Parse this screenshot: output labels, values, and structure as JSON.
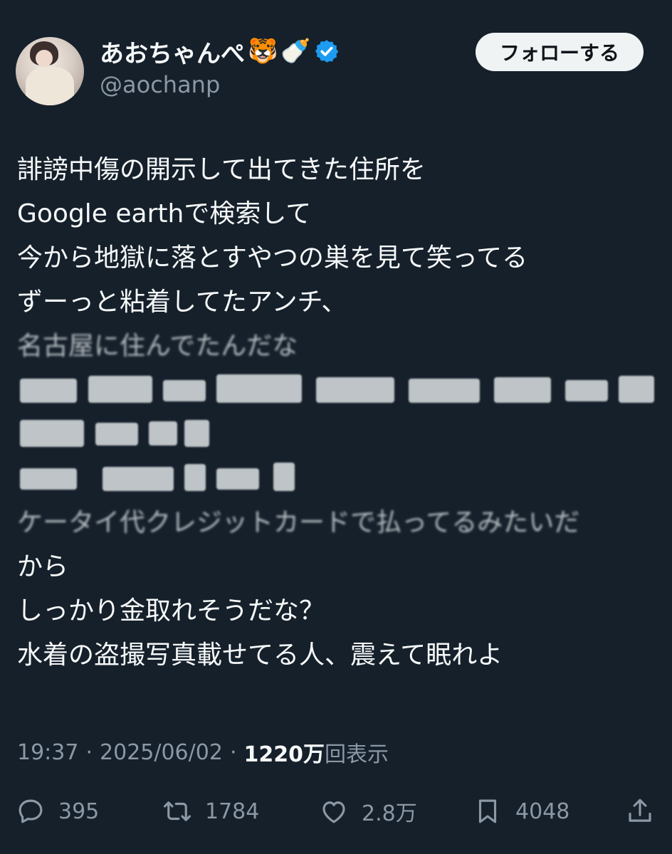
{
  "profile": {
    "display_name": "あおちゃんぺ",
    "name_emojis": [
      "🐯",
      "🍼"
    ],
    "handle": "@aochanp",
    "verified_icon": "verified-badge-icon"
  },
  "follow_button": {
    "label": "フォローする"
  },
  "tweet": {
    "lines": [
      "誹謗中傷の開示して出てきた住所を",
      "Google earthで検索して",
      "今から地獄に落とすやつの巣を見て笑ってる",
      "ずーっと粘着してたアンチ、"
    ],
    "blurred_line_1": "名古屋に住んでたんだな",
    "blurred_line_2": "ケータイ代クレジットカードで払ってるみたいだ",
    "tail_lines": [
      "から",
      "しっかり金取れそうだな？",
      "水着の盗撮写真載せてる人、震えて眠れよ"
    ]
  },
  "meta": {
    "time": "19:37",
    "separator": "·",
    "date": "2025/06/02",
    "views_count": "1220万",
    "views_label": "回表示"
  },
  "actions": {
    "reply": {
      "icon": "reply-icon",
      "count": "395"
    },
    "retweet": {
      "icon": "retweet-icon",
      "count": "1784"
    },
    "like": {
      "icon": "heart-icon",
      "count": "2.8万"
    },
    "bookmark": {
      "icon": "bookmark-icon",
      "count": "4048"
    },
    "share": {
      "icon": "share-icon"
    }
  },
  "colors": {
    "background": "#15202b",
    "text": "#f7f9f9",
    "secondary": "#8b98a5",
    "verified": "#1d9bf0",
    "follow_bg": "#eff3f4"
  }
}
